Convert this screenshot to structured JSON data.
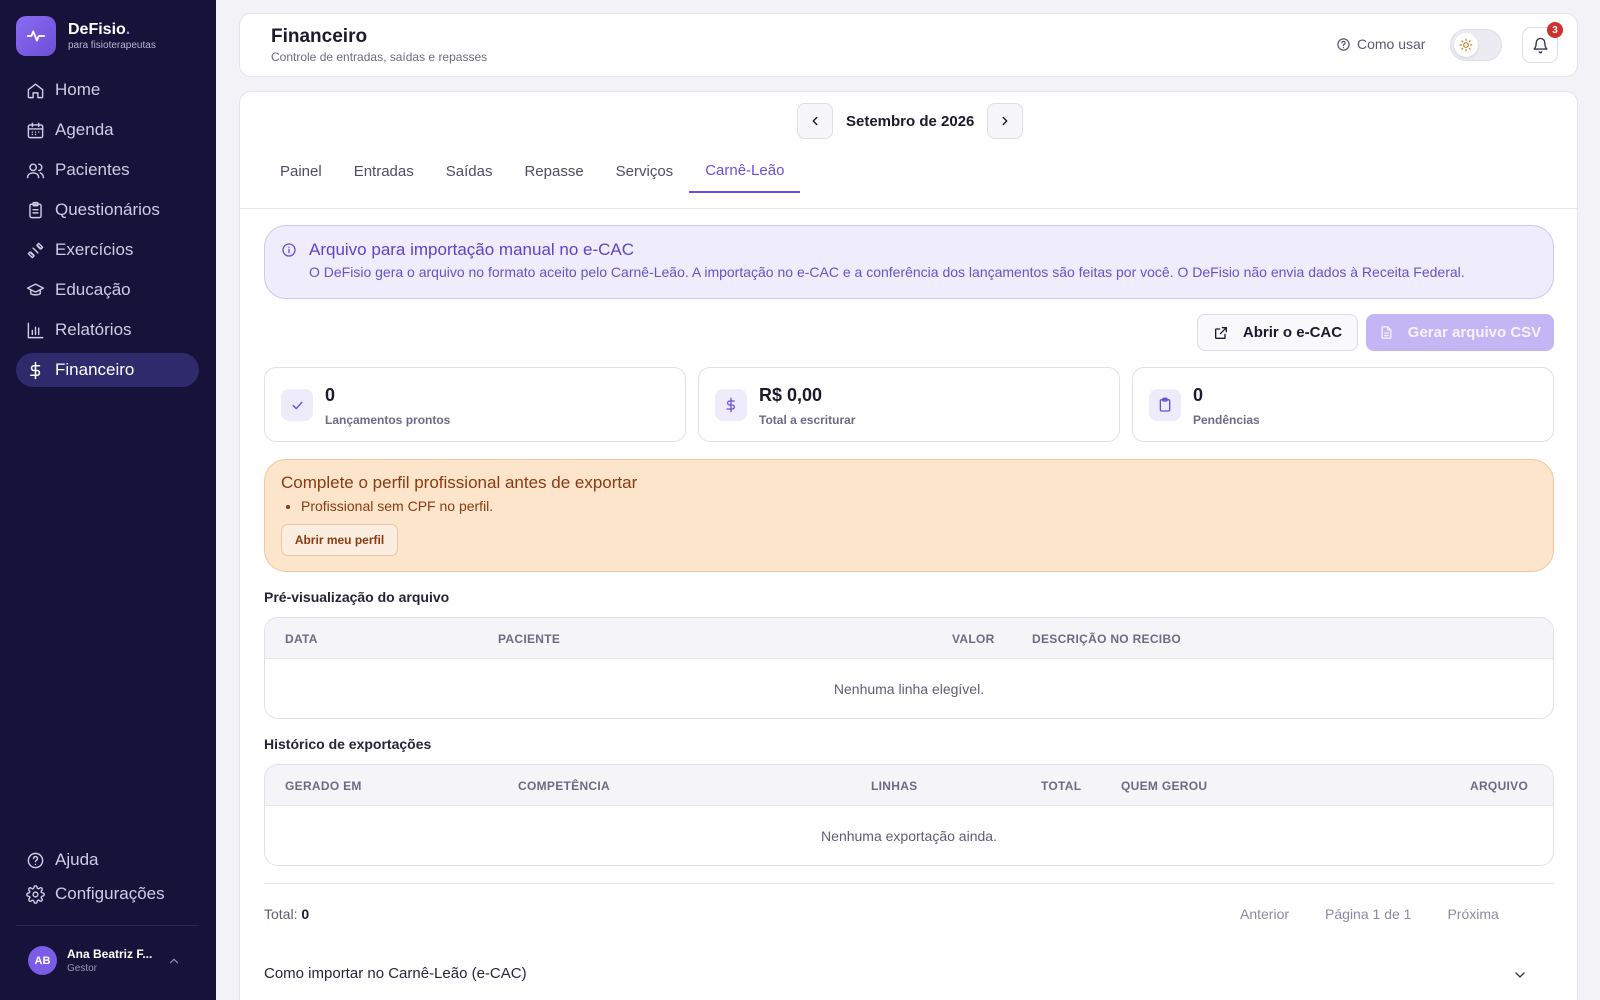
{
  "brand": {
    "name": "DeFisio",
    "dot": ".",
    "tagline": "para fisioterapeutas"
  },
  "sidebar": {
    "items": [
      {
        "label": "Home",
        "icon": "home-icon"
      },
      {
        "label": "Agenda",
        "icon": "calendar-icon"
      },
      {
        "label": "Pacientes",
        "icon": "users-icon"
      },
      {
        "label": "Questionários",
        "icon": "clipboard-icon"
      },
      {
        "label": "Exercícios",
        "icon": "dumbbell-icon"
      },
      {
        "label": "Educação",
        "icon": "graduation-cap-icon"
      },
      {
        "label": "Relatórios",
        "icon": "bar-chart-icon"
      },
      {
        "label": "Financeiro",
        "icon": "dollar-icon",
        "active": true
      }
    ],
    "bottom": [
      {
        "label": "Ajuda",
        "icon": "help-circle-icon"
      },
      {
        "label": "Configurações",
        "icon": "gear-icon"
      }
    ],
    "user": {
      "initials": "AB",
      "name": "Ana Beatriz F...",
      "role": "Gestor"
    }
  },
  "header": {
    "title": "Financeiro",
    "subtitle": "Controle de entradas, saídas e repasses",
    "help_label": "Como usar",
    "notifications": "3"
  },
  "month_nav": {
    "label": "Setembro de 2026"
  },
  "tabs": [
    {
      "label": "Painel"
    },
    {
      "label": "Entradas"
    },
    {
      "label": "Saídas"
    },
    {
      "label": "Repasse"
    },
    {
      "label": "Serviços"
    },
    {
      "label": "Carnê-Leão",
      "active": true
    }
  ],
  "info_banner": {
    "title": "Arquivo para importação manual no e-CAC",
    "text": "O DeFisio gera o arquivo no formato aceito pelo Carnê-Leão. A importação no e-CAC e a conferência dos lançamentos são feitas por você. O DeFisio não envia dados à Receita Federal."
  },
  "actions": {
    "open_ecac": "Abrir o e-CAC",
    "generate_csv": "Gerar arquivo CSV"
  },
  "stats": [
    {
      "value": "0",
      "label": "Lançamentos prontos",
      "icon": "check-icon"
    },
    {
      "value": "R$ 0,00",
      "label": "Total a escriturar",
      "icon": "dollar-icon"
    },
    {
      "value": "0",
      "label": "Pendências",
      "icon": "clipboard-icon"
    }
  ],
  "warning": {
    "title": "Complete o perfil profissional antes de exportar",
    "items": [
      "Profissional sem CPF no perfil."
    ],
    "button": "Abrir meu perfil"
  },
  "preview": {
    "title": "Pré-visualização do arquivo",
    "columns": [
      "DATA",
      "PACIENTE",
      "VALOR",
      "DESCRIÇÃO NO RECIBO"
    ],
    "empty": "Nenhuma linha elegível."
  },
  "history": {
    "title": "Histórico de exportações",
    "columns": [
      "GERADO EM",
      "COMPETÊNCIA",
      "LINHAS",
      "TOTAL",
      "QUEM GEROU",
      "ARQUIVO"
    ],
    "empty": "Nenhuma exportação ainda."
  },
  "footer": {
    "total_label": "Total:",
    "total_value": "0",
    "prev": "Anterior",
    "page": "Página 1 de 1",
    "next": "Próxima"
  },
  "accordion": {
    "title": "Como importar no Carnê-Leão (e-CAC)"
  },
  "colors": {
    "sidebar_bg": "#16123a",
    "accent": "#6c4fd8",
    "info_bg": "#efecfb",
    "warning_bg": "#fde5cb",
    "badge": "#d0312d"
  }
}
